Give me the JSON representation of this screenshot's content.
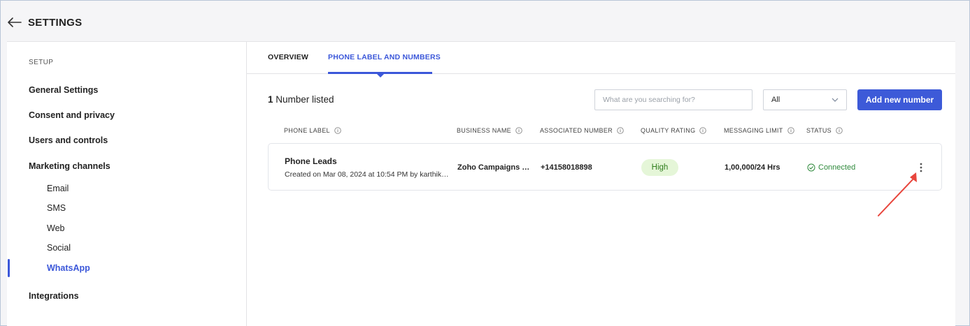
{
  "header": {
    "title": "SETTINGS"
  },
  "sidebar": {
    "section_label": "SETUP",
    "items": [
      {
        "label": "General Settings"
      },
      {
        "label": "Consent and privacy"
      },
      {
        "label": "Users and controls"
      },
      {
        "label": "Marketing channels"
      },
      {
        "label": "Integrations"
      }
    ],
    "sub_items": [
      {
        "label": "Email"
      },
      {
        "label": "SMS"
      },
      {
        "label": "Web"
      },
      {
        "label": "Social"
      },
      {
        "label": "WhatsApp",
        "active": true
      }
    ]
  },
  "tabs": [
    {
      "label": "OVERVIEW"
    },
    {
      "label": "PHONE LABEL AND NUMBERS",
      "active": true
    }
  ],
  "toolbar": {
    "count": "1",
    "count_suffix": "Number listed",
    "search_placeholder": "What are you searching for?",
    "filter_value": "All",
    "add_label": "Add new number"
  },
  "table": {
    "columns": [
      "PHONE LABEL",
      "BUSINESS NAME",
      "ASSOCIATED NUMBER",
      "QUALITY RATING",
      "MESSAGING LIMIT",
      "STATUS"
    ],
    "rows": [
      {
        "phone_label": "Phone Leads",
        "created": "Created on Mar 08, 2024 at 10:54 PM by karthik …",
        "business_name": "Zoho Campaigns Lo…",
        "associated_number": "+14158018898",
        "quality_rating": "High",
        "messaging_limit": "1,00,000/24 Hrs",
        "status": "Connected"
      }
    ]
  },
  "colors": {
    "accent": "#3b57d9",
    "quality_high_bg": "#e5f6d8",
    "status_connected": "#2f8a3c",
    "annotation_arrow": "#e8453c"
  },
  "icons": [
    "back-arrow-icon",
    "info-icon",
    "chevron-down-icon",
    "check-circle-icon",
    "more-vertical-icon"
  ]
}
